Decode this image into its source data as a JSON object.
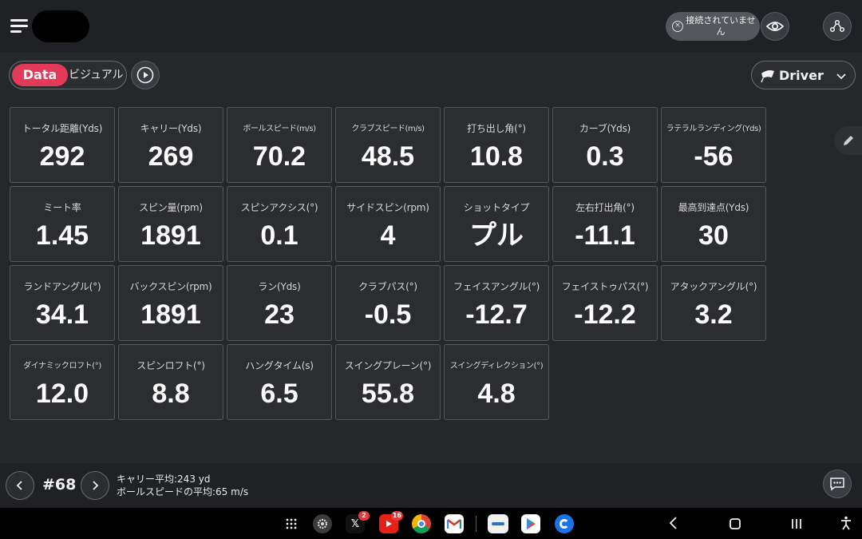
{
  "header": {
    "connection_status": "接続されていません"
  },
  "toolbar": {
    "toggle_active": "Data",
    "toggle_inactive": "ビジュアル",
    "club": "Driver"
  },
  "tiles": [
    {
      "label": "トータル距離(Yds)",
      "value": "292"
    },
    {
      "label": "キャリー(Yds)",
      "value": "269"
    },
    {
      "label": "ボールスピード(m/s)",
      "value": "70.2"
    },
    {
      "label": "クラブスピード(m/s)",
      "value": "48.5"
    },
    {
      "label": "打ち出し角(°)",
      "value": "10.8"
    },
    {
      "label": "カーブ(Yds)",
      "value": "0.3"
    },
    {
      "label": "ラテラルランディング(Yds)",
      "value": "-56"
    },
    {
      "label": "ミート率",
      "value": "1.45"
    },
    {
      "label": "スピン量(rpm)",
      "value": "1891"
    },
    {
      "label": "スピンアクシス(°)",
      "value": "0.1"
    },
    {
      "label": "サイドスピン(rpm)",
      "value": "4"
    },
    {
      "label": "ショットタイプ",
      "value": "プル"
    },
    {
      "label": "左右打出角(°)",
      "value": "-11.1"
    },
    {
      "label": "最高到達点(Yds)",
      "value": "30"
    },
    {
      "label": "ランドアングル(°)",
      "value": "34.1"
    },
    {
      "label": "バックスピン(rpm)",
      "value": "1891"
    },
    {
      "label": "ラン(Yds)",
      "value": "23"
    },
    {
      "label": "クラブパス(°)",
      "value": "-0.5"
    },
    {
      "label": "フェイスアングル(°)",
      "value": "-12.7"
    },
    {
      "label": "フェイストゥパス(°)",
      "value": "-12.2"
    },
    {
      "label": "アタックアングル(°)",
      "value": "3.2"
    },
    {
      "label": "ダイナミックロフト(°)",
      "value": "12.0"
    },
    {
      "label": "スピンロフト(°)",
      "value": "8.8"
    },
    {
      "label": "ハングタイム(s)",
      "value": "6.5"
    },
    {
      "label": "スイングプレーン(°)",
      "value": "55.8"
    },
    {
      "label": "スイングディレクション(°)",
      "value": "4.8"
    }
  ],
  "footer": {
    "shot_number": "#68",
    "carry_avg": "キャリー平均:243 yd",
    "ball_speed_avg": "ボールスピードの平均:65 m/s"
  },
  "system_bar": {
    "x_badge": "2",
    "youtube_badge": "16"
  },
  "colors": {
    "accent": "#e23a58",
    "background": "#25272b",
    "tile": "#2b2d31"
  }
}
